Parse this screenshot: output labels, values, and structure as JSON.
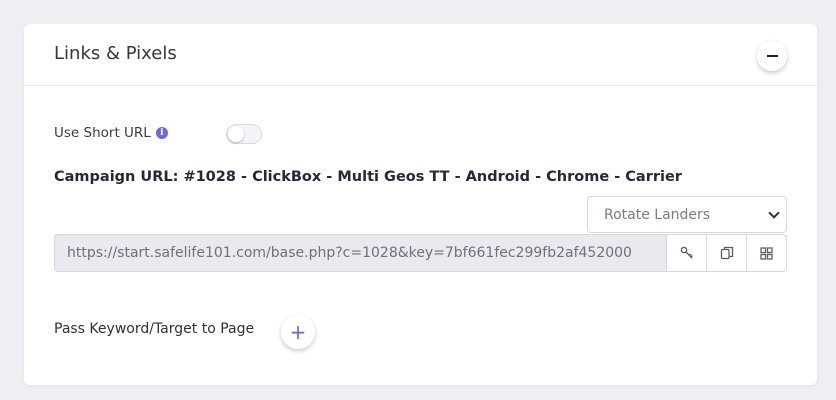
{
  "card": {
    "title": "Links & Pixels"
  },
  "short_url": {
    "label": "Use Short URL",
    "info_glyph": "i",
    "enabled": false
  },
  "campaign": {
    "label": "Campaign URL: #1028 - ClickBox - Multi Geos TT - Android - Chrome - Carrier",
    "url": "https://start.safelife101.com/base.php?c=1028&key=7bf661fec299fb2af452000"
  },
  "landers_select": {
    "selected": "Rotate Landers"
  },
  "pass_keyword": {
    "label": "Pass Keyword/Target to Page",
    "add_glyph": "+"
  },
  "icons": {
    "collapse": "minus-icon",
    "info": "info-icon",
    "key": "key-icon",
    "copy": "copy-icon",
    "qr": "qr-code-icon",
    "add": "plus-icon",
    "dropdown": "chevron-down-icon"
  },
  "colors": {
    "background": "#eeeef3",
    "card": "#ffffff",
    "accent": "#6f6bd8",
    "input_disabled": "#e9e9ee"
  }
}
